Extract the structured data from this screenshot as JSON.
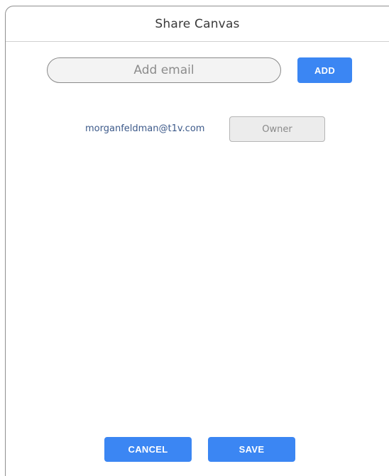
{
  "dialog": {
    "title": "Share Canvas"
  },
  "invite": {
    "email_placeholder": "Add email",
    "email_value": "",
    "add_label": "ADD"
  },
  "members": [
    {
      "email": "morganfeldman@t1v.com",
      "role": "Owner"
    }
  ],
  "footer": {
    "cancel_label": "CANCEL",
    "save_label": "SAVE"
  },
  "colors": {
    "accent": "#3b86f3",
    "member_email": "#3d5a8a",
    "role_bg": "#ececec"
  }
}
